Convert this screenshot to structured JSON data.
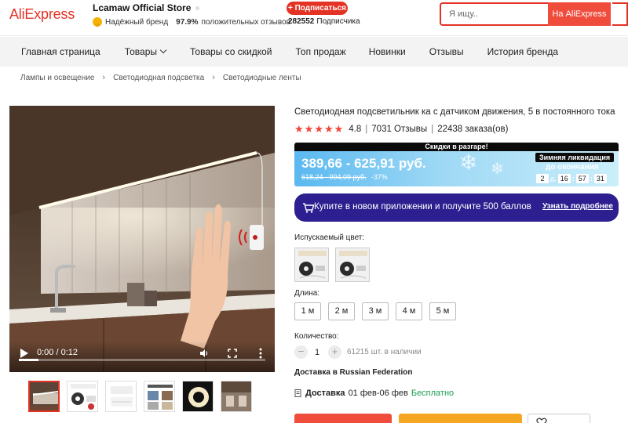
{
  "header": {
    "logo": "AliExpress",
    "store_name": "Lcamaw Official Store",
    "brand_badge": "Надёжный бренд",
    "positive_pct": "97.9%",
    "positive_label": "положительных отзывов",
    "subscribe_label": "+ Подписаться",
    "followers_count": "282552",
    "followers_label": "Подписчика",
    "search_placeholder": "Я ищу..",
    "search_button": "На AliExpress",
    "brand_color": "#e43225"
  },
  "nav": {
    "items": [
      {
        "label": "Главная страница"
      },
      {
        "label": "Товары"
      },
      {
        "label": "Товары со скидкой"
      },
      {
        "label": "Топ продаж"
      },
      {
        "label": "Новинки"
      },
      {
        "label": "Отзывы"
      },
      {
        "label": "История бренда"
      }
    ]
  },
  "breadcrumb": [
    "Лампы и освещение",
    "Светодиодная подсветка",
    "Светодиодные ленты"
  ],
  "video": {
    "time": "0:00 / 0:12",
    "progress": 0.08
  },
  "product": {
    "title": "Светодиодная подсветильник ка с датчиком движения, 5 в постоянного тока",
    "rating": "4.8",
    "stars": 5,
    "reviews": "7031 Отзывы",
    "orders": "22438 заказа(ов)",
    "promo_header": "Скидки в разгаре!",
    "price": "389,66 - 625,91 руб.",
    "old_price": "618,24 - 994,09 руб.",
    "discount": "-37%",
    "winter_badge": "Зимняя ликвидация",
    "until_label": "до окончания",
    "timer": {
      "days": "2",
      "days_label": "д.",
      "hours": "16",
      "minutes": "57",
      "seconds": "31"
    },
    "app_banner_text": "Купите в новом приложении и получите 500 баллов",
    "app_banner_link": "Узнать подробнее",
    "color_label": "Испускаемый цвет:",
    "length_label": "Длина:",
    "lengths": [
      "1 м",
      "2 м",
      "3 м",
      "4 м",
      "5 м"
    ],
    "quantity_label": "Количество:",
    "quantity": "1",
    "stock": "61215 шт. в наличии",
    "shipping_title": "Доставка в Russian Federation",
    "delivery_label": "Доставка",
    "delivery_dates": "01 фев-06 фев",
    "delivery_price": "Бесплатно"
  }
}
